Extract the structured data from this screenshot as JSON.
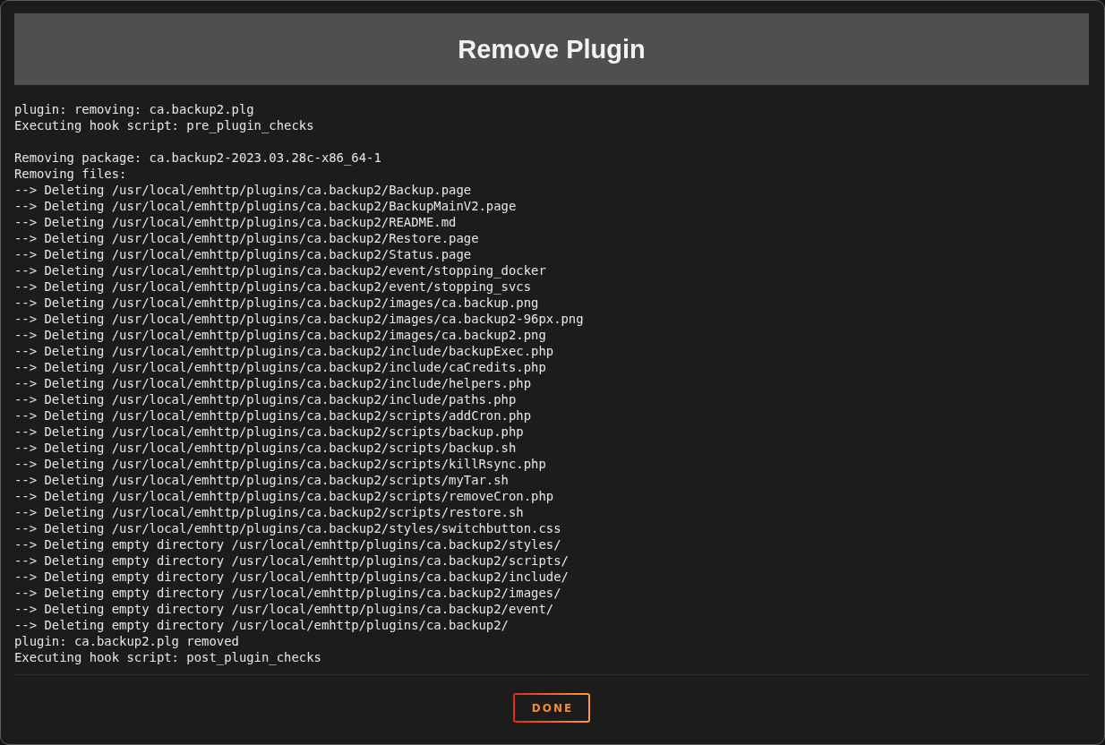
{
  "dialog": {
    "title": "Remove Plugin",
    "log": {
      "blocks": [
        {
          "lines": [
            "plugin: removing: ca.backup2.plg",
            "Executing hook script: pre_plugin_checks"
          ]
        },
        {
          "lines": [
            "Removing package: ca.backup2-2023.03.28c-x86_64-1",
            "Removing files:",
            "--> Deleting /usr/local/emhttp/plugins/ca.backup2/Backup.page",
            "--> Deleting /usr/local/emhttp/plugins/ca.backup2/BackupMainV2.page",
            "--> Deleting /usr/local/emhttp/plugins/ca.backup2/README.md",
            "--> Deleting /usr/local/emhttp/plugins/ca.backup2/Restore.page",
            "--> Deleting /usr/local/emhttp/plugins/ca.backup2/Status.page",
            "--> Deleting /usr/local/emhttp/plugins/ca.backup2/event/stopping_docker",
            "--> Deleting /usr/local/emhttp/plugins/ca.backup2/event/stopping_svcs",
            "--> Deleting /usr/local/emhttp/plugins/ca.backup2/images/ca.backup.png",
            "--> Deleting /usr/local/emhttp/plugins/ca.backup2/images/ca.backup2-96px.png",
            "--> Deleting /usr/local/emhttp/plugins/ca.backup2/images/ca.backup2.png",
            "--> Deleting /usr/local/emhttp/plugins/ca.backup2/include/backupExec.php",
            "--> Deleting /usr/local/emhttp/plugins/ca.backup2/include/caCredits.php",
            "--> Deleting /usr/local/emhttp/plugins/ca.backup2/include/helpers.php",
            "--> Deleting /usr/local/emhttp/plugins/ca.backup2/include/paths.php",
            "--> Deleting /usr/local/emhttp/plugins/ca.backup2/scripts/addCron.php",
            "--> Deleting /usr/local/emhttp/plugins/ca.backup2/scripts/backup.php",
            "--> Deleting /usr/local/emhttp/plugins/ca.backup2/scripts/backup.sh",
            "--> Deleting /usr/local/emhttp/plugins/ca.backup2/scripts/killRsync.php",
            "--> Deleting /usr/local/emhttp/plugins/ca.backup2/scripts/myTar.sh",
            "--> Deleting /usr/local/emhttp/plugins/ca.backup2/scripts/removeCron.php",
            "--> Deleting /usr/local/emhttp/plugins/ca.backup2/scripts/restore.sh",
            "--> Deleting /usr/local/emhttp/plugins/ca.backup2/styles/switchbutton.css",
            "--> Deleting empty directory /usr/local/emhttp/plugins/ca.backup2/styles/",
            "--> Deleting empty directory /usr/local/emhttp/plugins/ca.backup2/scripts/",
            "--> Deleting empty directory /usr/local/emhttp/plugins/ca.backup2/include/",
            "--> Deleting empty directory /usr/local/emhttp/plugins/ca.backup2/images/",
            "--> Deleting empty directory /usr/local/emhttp/plugins/ca.backup2/event/",
            "--> Deleting empty directory /usr/local/emhttp/plugins/ca.backup2/",
            "plugin: ca.backup2.plg removed",
            "Executing hook script: post_plugin_checks"
          ]
        }
      ]
    },
    "buttons": [
      "DONE"
    ]
  }
}
